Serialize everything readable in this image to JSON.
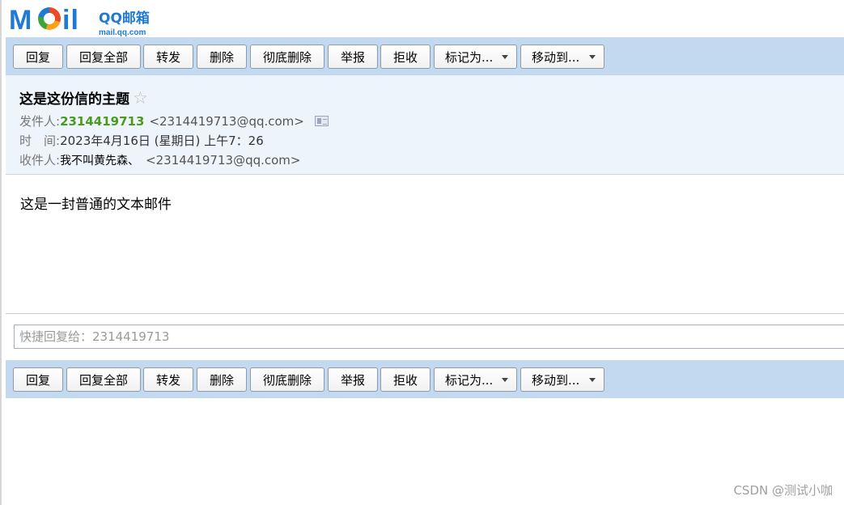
{
  "logo": {
    "mail_part1": "M",
    "mail_part2": "il",
    "brand": "QQ邮箱",
    "domain": "mail.qq.com"
  },
  "toolbar": {
    "buttons": [
      {
        "label": "回复"
      },
      {
        "label": "回复全部"
      },
      {
        "label": "转发"
      },
      {
        "label": "删除"
      },
      {
        "label": "彻底删除"
      },
      {
        "label": "举报"
      },
      {
        "label": "拒收"
      },
      {
        "label": "标记为..."
      },
      {
        "label": "移动到..."
      }
    ]
  },
  "mail": {
    "subject": "这是这份信的主题",
    "star_icon": "☆",
    "from_label": "发件人:",
    "from_name": "2314419713",
    "from_address": "<2314419713@qq.com>",
    "time_label": "时　间:",
    "time_value": "2023年4月16日 (星期日) 上午7：26",
    "to_label": "收件人:",
    "to_name": "我不叫黄先森、",
    "to_address": "<2314419713@qq.com>",
    "body": "这是一封普通的文本邮件"
  },
  "quick_reply": {
    "placeholder": "快捷回复给：2314419713"
  },
  "watermark": "CSDN @测试小咖",
  "colors": {
    "toolbar_bg": "#c3d9ef",
    "header_bg": "#eef4fb",
    "sender_green": "#4b9a1e",
    "brand_blue": "#1f7ad6"
  }
}
